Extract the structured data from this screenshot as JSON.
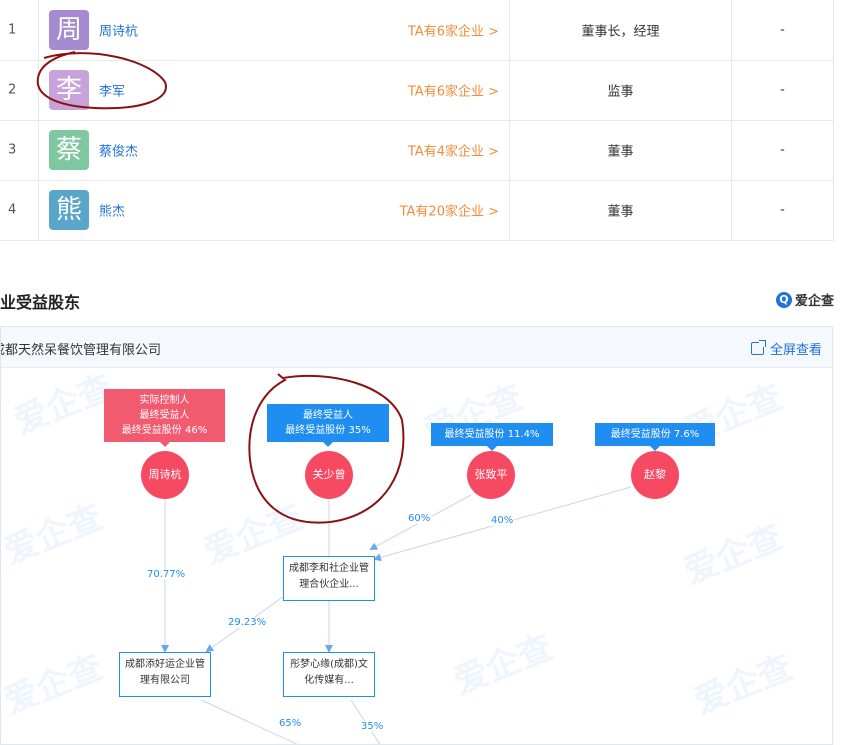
{
  "people": [
    {
      "index": "1",
      "avatar_char": "周",
      "avatar_color": "#a58bd0",
      "name": "周诗杭",
      "ta_link": "TA有6家企业 >",
      "role": "董事长，经理",
      "rate": "-"
    },
    {
      "index": "2",
      "avatar_char": "李",
      "avatar_color": "#c7a3d9",
      "name": "李军",
      "ta_link": "TA有6家企业 >",
      "role": "监事",
      "rate": "-"
    },
    {
      "index": "3",
      "avatar_char": "蔡",
      "avatar_color": "#7fc7a0",
      "name": "蔡俊杰",
      "ta_link": "TA有4家企业 >",
      "role": "董事",
      "rate": "-"
    },
    {
      "index": "4",
      "avatar_char": "熊",
      "avatar_color": "#5aa6c9",
      "name": "熊杰",
      "ta_link": "TA有20家企业 >",
      "role": "董事",
      "rate": "-"
    }
  ],
  "section": {
    "title": "企业受益股东",
    "brand": "爱企查",
    "brand_icon": "magnifier-logo-icon",
    "company": "成都天然呆餐饮管理有限公司",
    "fullscreen_label": "全屏查看",
    "fullscreen_icon": "expand-icon",
    "watermark": "爱企查"
  },
  "graph": {
    "holders": [
      {
        "name": "周诗杭",
        "tag_lines": [
          "实际控制人",
          "最终受益人",
          "最终受益股份 46%"
        ],
        "tag_color": "red"
      },
      {
        "name": "关少曾",
        "tag_lines": [
          "最终受益人",
          "最终受益股份 35%"
        ],
        "tag_color": "blue"
      },
      {
        "name": "张致平",
        "tag_lines": [
          "最终受益股份 11.4%"
        ],
        "tag_color": "blue"
      },
      {
        "name": "赵黎",
        "tag_lines": [
          "最终受益股份 7.6%"
        ],
        "tag_color": "blue"
      }
    ],
    "entities": [
      {
        "name": "成都李和社企业管理合伙企业..."
      },
      {
        "name": "成都添好运企业管理有限公司"
      },
      {
        "name": "彤梦心缘(成都)文化传媒有..."
      }
    ],
    "percentages": [
      "60%",
      "40%",
      "70.77%",
      "29.23%",
      "65%",
      "35%"
    ]
  },
  "colors": {
    "link": "#1f73d9",
    "orange": "#f28c3b",
    "node_red": "#f54a62",
    "tag_blue": "#1f8ef0",
    "tag_red": "#f25a6f"
  }
}
